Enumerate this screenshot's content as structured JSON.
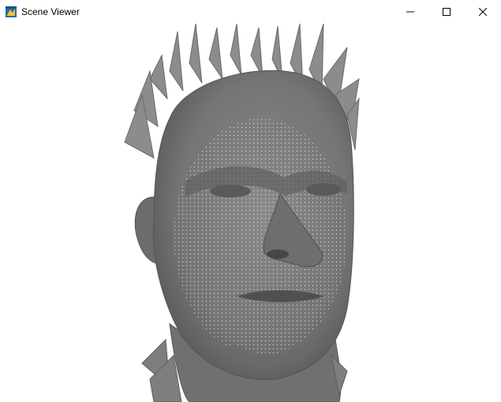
{
  "window": {
    "title": "Scene Viewer",
    "icon": "app-icon",
    "controls": [
      "minimize-icon",
      "maximize-icon",
      "close-icon"
    ]
  },
  "scene": {
    "background_color": "#ffffff",
    "mesh_color": "#7a7a7a",
    "mesh_shadow_color": "#5c5c5c",
    "point_color": "#ffffff",
    "content": "3d-head-mesh"
  }
}
